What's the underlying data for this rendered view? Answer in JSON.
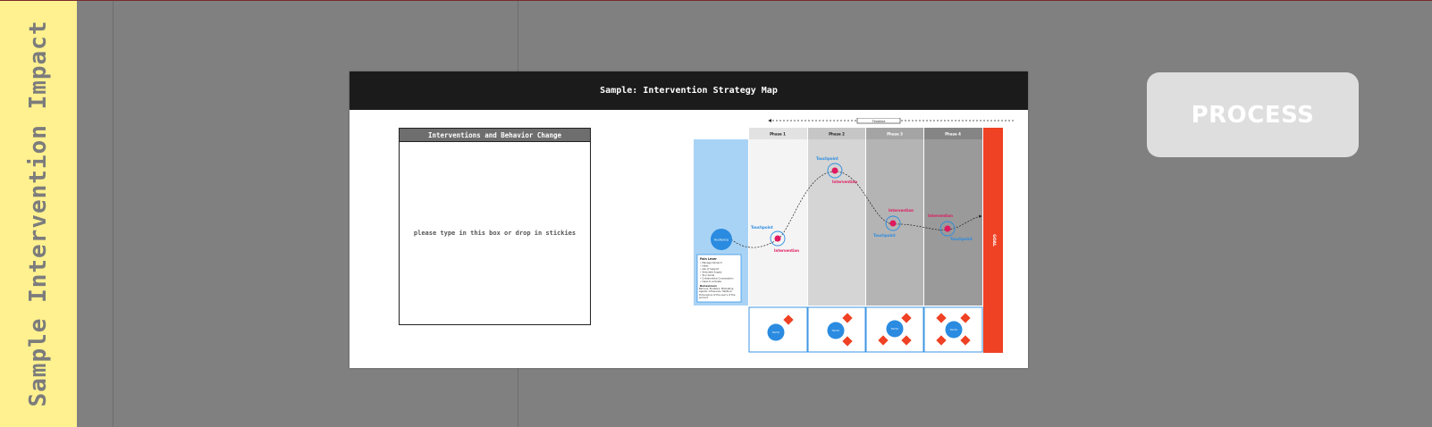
{
  "sidebar": {
    "title": "Sample Intervention Impact"
  },
  "board": {
    "title": "Sample: Intervention Strategy Map",
    "interventions_box": {
      "header": "Interventions and Behavior Change",
      "placeholder": "please type in this box or drop in stickies"
    },
    "map": {
      "timeline_label": "Timeline",
      "phases": [
        "Phase 1",
        "Phase 2",
        "Phase 3",
        "Phase 4"
      ],
      "start_label": "Audience",
      "goal_label": "GOAL",
      "touchpoint_label": "Touchpoint",
      "intervention_label": "Intervention",
      "notes_title": "Pain Lever",
      "notes_lines": [
        "• Manage Demand",
        "• Ideas",
        "• Ask of Support",
        "• Stimulate Supply",
        "• Tour Guide",
        "• Collaborative Consumption",
        "• Ideas to activate"
      ],
      "notes_title2": "Behaviours",
      "notes_text2": "Barriers, Enablers, Motivating Agents, Influences, Habitual Dimensions of the user's of the product",
      "phase_nodes": [
        "Tactic",
        "Tactic",
        "Tactic",
        "Tactic"
      ],
      "colors": {
        "audience": "#a9d3f5",
        "goal": "#ef4123",
        "accent_blue": "#2a8be0",
        "accent_pink": "#e0185f"
      }
    }
  },
  "process_card": {
    "label": "PROCESS"
  }
}
